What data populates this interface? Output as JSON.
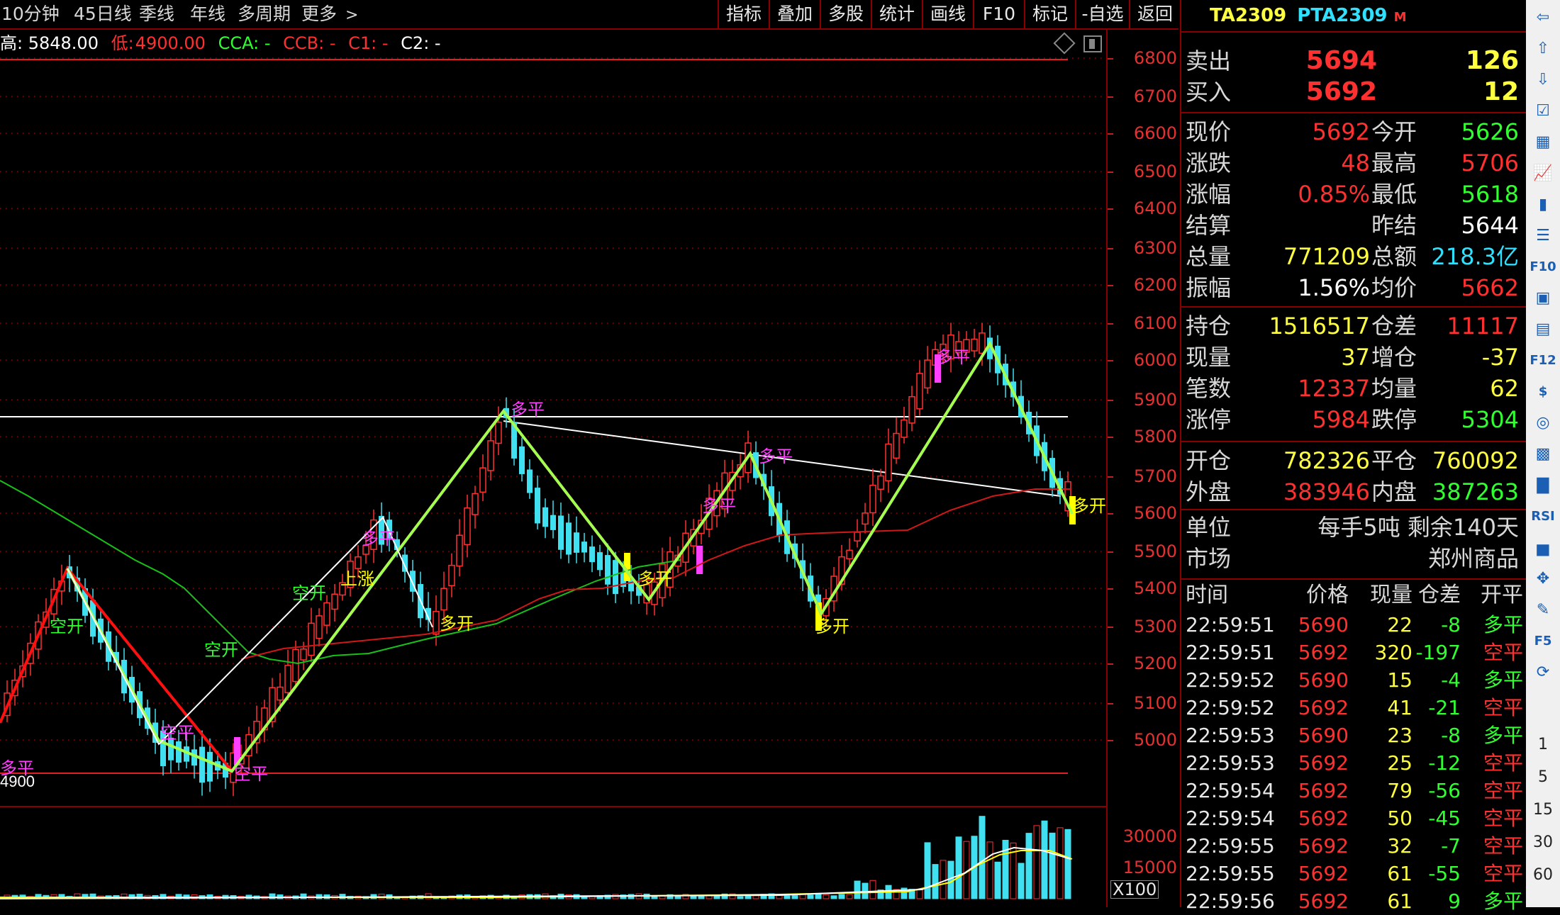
{
  "toolbar": {
    "left_items": [
      "10分钟",
      "45日线",
      "季线",
      "年线",
      "多周期",
      "更多"
    ],
    "right_items": [
      "指标",
      "叠加",
      "多股",
      "统计",
      "画线",
      "F10",
      "标记",
      "-自选",
      "返回"
    ]
  },
  "infoline": {
    "high": "高: 5848.00",
    "low_label": "低:",
    "low_value": "4900.00",
    "cca": "CCA: -",
    "ccb": "CCB: -",
    "c1": "C1: -",
    "c2": "C2: -"
  },
  "price_axis": [
    "6800",
    "6700",
    "6600",
    "6500",
    "6400",
    "6300",
    "6200",
    "6100",
    "6000",
    "5900",
    "5800",
    "5700",
    "5600",
    "5500",
    "5400",
    "5300",
    "5200",
    "5100",
    "5000"
  ],
  "volume_axis": [
    "30000",
    "15000",
    "X100"
  ],
  "chart_labels": {
    "low_line_value": "4900",
    "signals": [
      {
        "text": "空开",
        "color": "#30ff30"
      },
      {
        "text": "空平",
        "color": "#ff40ff"
      },
      {
        "text": "空开",
        "color": "#30ff30"
      },
      {
        "text": "空平",
        "color": "#ff40ff"
      },
      {
        "text": "空开",
        "color": "#30ff30"
      },
      {
        "text": "上涨",
        "color": "#ffff00"
      },
      {
        "text": "多平",
        "color": "#ff40ff"
      },
      {
        "text": "多开",
        "color": "#ffff00"
      },
      {
        "text": "多平",
        "color": "#ff40ff"
      },
      {
        "text": "多开",
        "color": "#ffff00"
      },
      {
        "text": "多平",
        "color": "#ff40ff"
      },
      {
        "text": "多平",
        "color": "#ff40ff"
      },
      {
        "text": "多开",
        "color": "#ffff00"
      },
      {
        "text": "多平",
        "color": "#ff40ff"
      },
      {
        "text": "多开",
        "color": "#ffff00"
      },
      {
        "text": "多平",
        "color": "#ff40ff"
      }
    ]
  },
  "panel": {
    "symbol": "TA2309",
    "name": "PTA2309",
    "flag": "M",
    "ask_label": "卖出",
    "ask_price": "5694",
    "ask_vol": "126",
    "bid_label": "买入",
    "bid_price": "5692",
    "bid_vol": "12",
    "stats": [
      {
        "l1": "现价",
        "v1": "5692",
        "c1": "#ff3030",
        "l2": "今开",
        "v2": "5626",
        "c2": "#30ff30"
      },
      {
        "l1": "涨跌",
        "v1": "48",
        "c1": "#ff3030",
        "l2": "最高",
        "v2": "5706",
        "c2": "#ff3030"
      },
      {
        "l1": "涨幅",
        "v1": "0.85%",
        "c1": "#ff3030",
        "l2": "最低",
        "v2": "5618",
        "c2": "#30ff30"
      },
      {
        "l1": "结算",
        "v1": "",
        "c1": "#ffffff",
        "l2": "昨结",
        "v2": "5644",
        "c2": "#ffffff"
      },
      {
        "l1": "总量",
        "v1": "771209",
        "c1": "#ffff40",
        "l2": "总额",
        "v2": "218.3亿",
        "c2": "#30e0ff"
      },
      {
        "l1": "振幅",
        "v1": "1.56%",
        "c1": "#ffffff",
        "l2": "均价",
        "v2": "5662",
        "c2": "#ff3030"
      }
    ],
    "stats2": [
      {
        "l1": "持仓",
        "v1": "1516517",
        "c1": "#ffff40",
        "l2": "仓差",
        "v2": "11117",
        "c2": "#ff3030"
      },
      {
        "l1": "现量",
        "v1": "37",
        "c1": "#ffff40",
        "l2": "增仓",
        "v2": "-37",
        "c2": "#ffff40"
      },
      {
        "l1": "笔数",
        "v1": "12337",
        "c1": "#ff3030",
        "l2": "均量",
        "v2": "62",
        "c2": "#ffff40"
      },
      {
        "l1": "涨停",
        "v1": "5984",
        "c1": "#ff3030",
        "l2": "跌停",
        "v2": "5304",
        "c2": "#30ff30"
      }
    ],
    "stats3": [
      {
        "l1": "开仓",
        "v1": "782326",
        "c1": "#ffff40",
        "l2": "平仓",
        "v2": "760092",
        "c2": "#ffff40"
      },
      {
        "l1": "外盘",
        "v1": "383946",
        "c1": "#ff3030",
        "l2": "内盘",
        "v2": "387263",
        "c2": "#30ff30"
      }
    ],
    "unit_label": "单位",
    "unit_value": "每手5吨 剩余140天",
    "market_label": "市场",
    "market_value": "郑州商品",
    "tick_headers": [
      "时间",
      "价格",
      "现量",
      "仓差",
      "开平"
    ],
    "ticks": [
      {
        "t": "22:59:51",
        "p": "5690",
        "v": "22",
        "d": "-8",
        "k": "多平",
        "kc": "#30ff30"
      },
      {
        "t": "22:59:51",
        "p": "5692",
        "v": "320",
        "d": "-197",
        "k": "空平",
        "kc": "#ff3030"
      },
      {
        "t": "22:59:52",
        "p": "5690",
        "v": "15",
        "d": "-4",
        "k": "多平",
        "kc": "#30ff30"
      },
      {
        "t": "22:59:52",
        "p": "5692",
        "v": "41",
        "d": "-21",
        "k": "空平",
        "kc": "#ff3030"
      },
      {
        "t": "22:59:53",
        "p": "5690",
        "v": "23",
        "d": "-8",
        "k": "多平",
        "kc": "#30ff30"
      },
      {
        "t": "22:59:53",
        "p": "5692",
        "v": "25",
        "d": "-12",
        "k": "空平",
        "kc": "#ff3030"
      },
      {
        "t": "22:59:54",
        "p": "5692",
        "v": "79",
        "d": "-56",
        "k": "空平",
        "kc": "#ff3030"
      },
      {
        "t": "22:59:54",
        "p": "5692",
        "v": "50",
        "d": "-45",
        "k": "空平",
        "kc": "#ff3030"
      },
      {
        "t": "22:59:55",
        "p": "5692",
        "v": "32",
        "d": "-7",
        "k": "空平",
        "kc": "#ff3030"
      },
      {
        "t": "22:59:55",
        "p": "5692",
        "v": "61",
        "d": "-55",
        "k": "空平",
        "kc": "#ff3030"
      },
      {
        "t": "22:59:56",
        "p": "5692",
        "v": "61",
        "d": "9",
        "k": "多平",
        "kc": "#30ff30"
      }
    ]
  },
  "sidebar": {
    "icons": [
      "arrow-left-icon",
      "arrow-up-icon",
      "arrow-down-icon",
      "checklist-icon",
      "table-icon",
      "line-chart-icon",
      "candlestick-icon",
      "list-icon",
      "f10-icon",
      "calendar-icon",
      "book-icon",
      "f12-icon",
      "dollar-icon",
      "circle-icon",
      "grid-icon",
      "chart-bars-icon",
      "rsi-icon",
      "chart-bars2-icon",
      "move-icon",
      "pencil-icon",
      "f5-icon",
      "refresh-icon"
    ],
    "icon_labels": {
      "f10-icon": "F10",
      "f12-icon": "F12",
      "rsi-icon": "RSI",
      "f5-icon": "F5",
      "dollar-icon": "$"
    },
    "numbers": [
      "1",
      "5",
      "15",
      "30",
      "60"
    ]
  }
}
